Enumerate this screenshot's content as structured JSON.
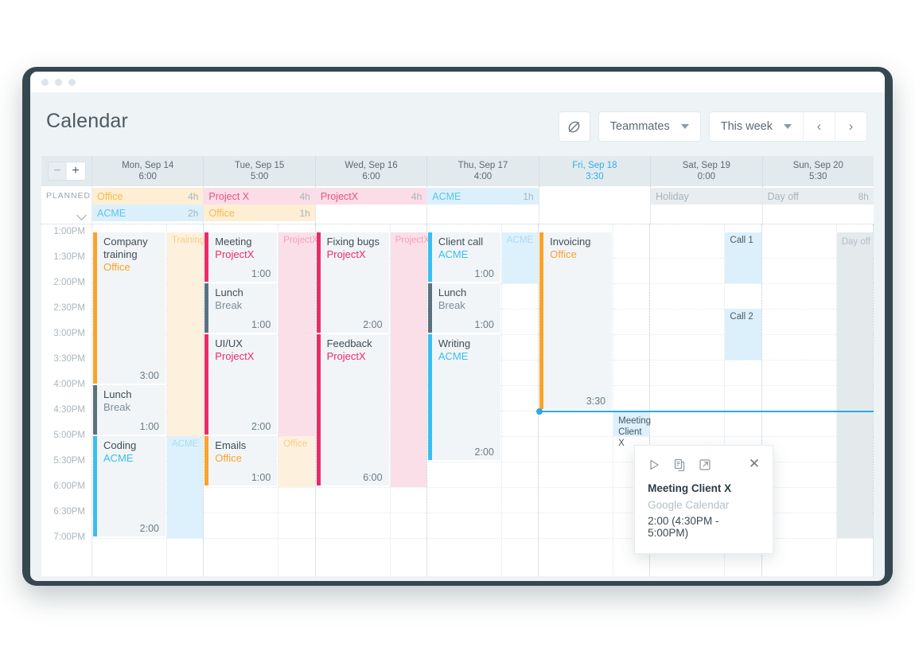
{
  "window": {
    "dots": 3
  },
  "header": {
    "title": "Calendar",
    "integrations_icon": "plug-slash-icon",
    "teammates_label": "Teammates",
    "week_label": "This week",
    "prev_label": "‹",
    "next_label": "›"
  },
  "stepper": {
    "minus": "−",
    "plus": "+"
  },
  "planned": {
    "label": "PLANNED",
    "collapse_icon": "chevron-down-icon"
  },
  "days": [
    {
      "name": "Mon, Sep 14",
      "total": "6:00",
      "today": false,
      "planned": [
        {
          "label": "Office",
          "amount": "4h",
          "kind": "office"
        },
        {
          "label": "ACME",
          "amount": "2h",
          "kind": "acme"
        }
      ]
    },
    {
      "name": "Tue, Sep 15",
      "total": "5:00",
      "today": false,
      "planned": [
        {
          "label": "Project X",
          "amount": "4h",
          "kind": "projx"
        },
        {
          "label": "Office",
          "amount": "1h",
          "kind": "office"
        }
      ]
    },
    {
      "name": "Wed, Sep 16",
      "total": "6:00",
      "today": false,
      "planned": [
        {
          "label": "ProjectX",
          "amount": "4h",
          "kind": "projx"
        }
      ]
    },
    {
      "name": "Thu, Sep 17",
      "total": "4:00",
      "today": false,
      "planned": [
        {
          "label": "ACME",
          "amount": "1h",
          "kind": "acme"
        }
      ]
    },
    {
      "name": "Fri, Sep 18",
      "total": "3:30",
      "today": true,
      "planned": []
    },
    {
      "name": "Sat, Sep 19",
      "total": "0:00",
      "today": false,
      "planned": [
        {
          "label": "Holiday",
          "amount": "",
          "kind": "neutral"
        }
      ]
    },
    {
      "name": "Sun, Sep 20",
      "total": "5:30",
      "today": false,
      "planned": [
        {
          "label": "Day off",
          "amount": "8h",
          "kind": "neutral"
        }
      ]
    }
  ],
  "timescale": {
    "labels": [
      "1:00PM",
      "1:30PM",
      "2:00PM",
      "2:30PM",
      "3:00PM",
      "3:30PM",
      "4:00PM",
      "4:30PM",
      "5:00PM",
      "5:30PM",
      "6:00PM",
      "6:30PM",
      "7:00PM"
    ]
  },
  "events": [
    {
      "day": 0,
      "title": "Company training",
      "project": "Office",
      "kind": "office",
      "duration": "3:00",
      "start": 0,
      "span": 6
    },
    {
      "day": 0,
      "title": "Lunch",
      "project": "Break",
      "kind": "break",
      "duration": "1:00",
      "start": 6,
      "span": 2
    },
    {
      "day": 0,
      "title": "Coding",
      "project": "ACME",
      "kind": "acme",
      "duration": "2:00",
      "start": 8,
      "span": 4
    },
    {
      "day": 1,
      "title": "Meeting",
      "project": "ProjectX",
      "kind": "projx",
      "duration": "1:00",
      "start": 0,
      "span": 2
    },
    {
      "day": 1,
      "title": "Lunch",
      "project": "Break",
      "kind": "break",
      "duration": "1:00",
      "start": 2,
      "span": 2
    },
    {
      "day": 1,
      "title": "UI/UX",
      "project": "ProjectX",
      "kind": "projx",
      "duration": "2:00",
      "start": 4,
      "span": 4
    },
    {
      "day": 1,
      "title": "Emails",
      "project": "Office",
      "kind": "office",
      "duration": "1:00",
      "start": 8,
      "span": 2
    },
    {
      "day": 2,
      "title": "Fixing bugs",
      "project": "ProjectX",
      "kind": "projx",
      "duration": "2:00",
      "start": 0,
      "span": 4
    },
    {
      "day": 2,
      "title": "Feedback",
      "project": "ProjectX",
      "kind": "projx",
      "duration": "6:00",
      "start": 4,
      "span": 6
    },
    {
      "day": 3,
      "title": "Client call",
      "project": "ACME",
      "kind": "acme",
      "duration": "1:00",
      "start": 0,
      "span": 2
    },
    {
      "day": 3,
      "title": "Lunch",
      "project": "Break",
      "kind": "break",
      "duration": "1:00",
      "start": 2,
      "span": 2
    },
    {
      "day": 3,
      "title": "Writing",
      "project": "ACME",
      "kind": "acme",
      "duration": "2:00",
      "start": 4,
      "span": 5
    },
    {
      "day": 4,
      "title": "Invoicing",
      "project": "Office",
      "kind": "office",
      "duration": "3:30",
      "start": 0,
      "span": 7
    }
  ],
  "planned_blocks": [
    {
      "day": 0,
      "label": "Training",
      "kind": "office",
      "start": 0,
      "span": 8
    },
    {
      "day": 0,
      "label": "ACME",
      "kind": "acme",
      "start": 8,
      "span": 4
    },
    {
      "day": 1,
      "label": "ProjectX",
      "kind": "projx",
      "start": 0,
      "span": 8
    },
    {
      "day": 1,
      "label": "Office",
      "kind": "office",
      "start": 8,
      "span": 2
    },
    {
      "day": 2,
      "label": "ProjectX",
      "kind": "projx",
      "start": 0,
      "span": 10
    },
    {
      "day": 3,
      "label": "ACME",
      "kind": "acme",
      "start": 0,
      "span": 2
    },
    {
      "day": 5,
      "label": "Call 1",
      "kind": "call",
      "start": 0,
      "span": 2
    },
    {
      "day": 5,
      "label": "Call 2",
      "kind": "call",
      "start": 3,
      "span": 2
    },
    {
      "day": 6,
      "label": "Day off",
      "kind": "off",
      "start": 0,
      "span": 12
    }
  ],
  "now": {
    "time": "3:30",
    "day": 4
  },
  "mini_event": {
    "line1": "Meeting",
    "line2": "Client X"
  },
  "popup": {
    "play_icon": "play-icon",
    "copy_icon": "copy-icon",
    "open_icon": "open-external-icon",
    "close_icon": "close-icon",
    "title": "Meeting Client X",
    "source": "Google Calendar",
    "detail": "2:00 (4:30PM - 5:00PM)"
  },
  "colors": {
    "office": "#faa32a",
    "acme": "#3bbdf0",
    "projectx": "#ec2b67",
    "break": "#5b717e",
    "today": "#2eafe8"
  }
}
